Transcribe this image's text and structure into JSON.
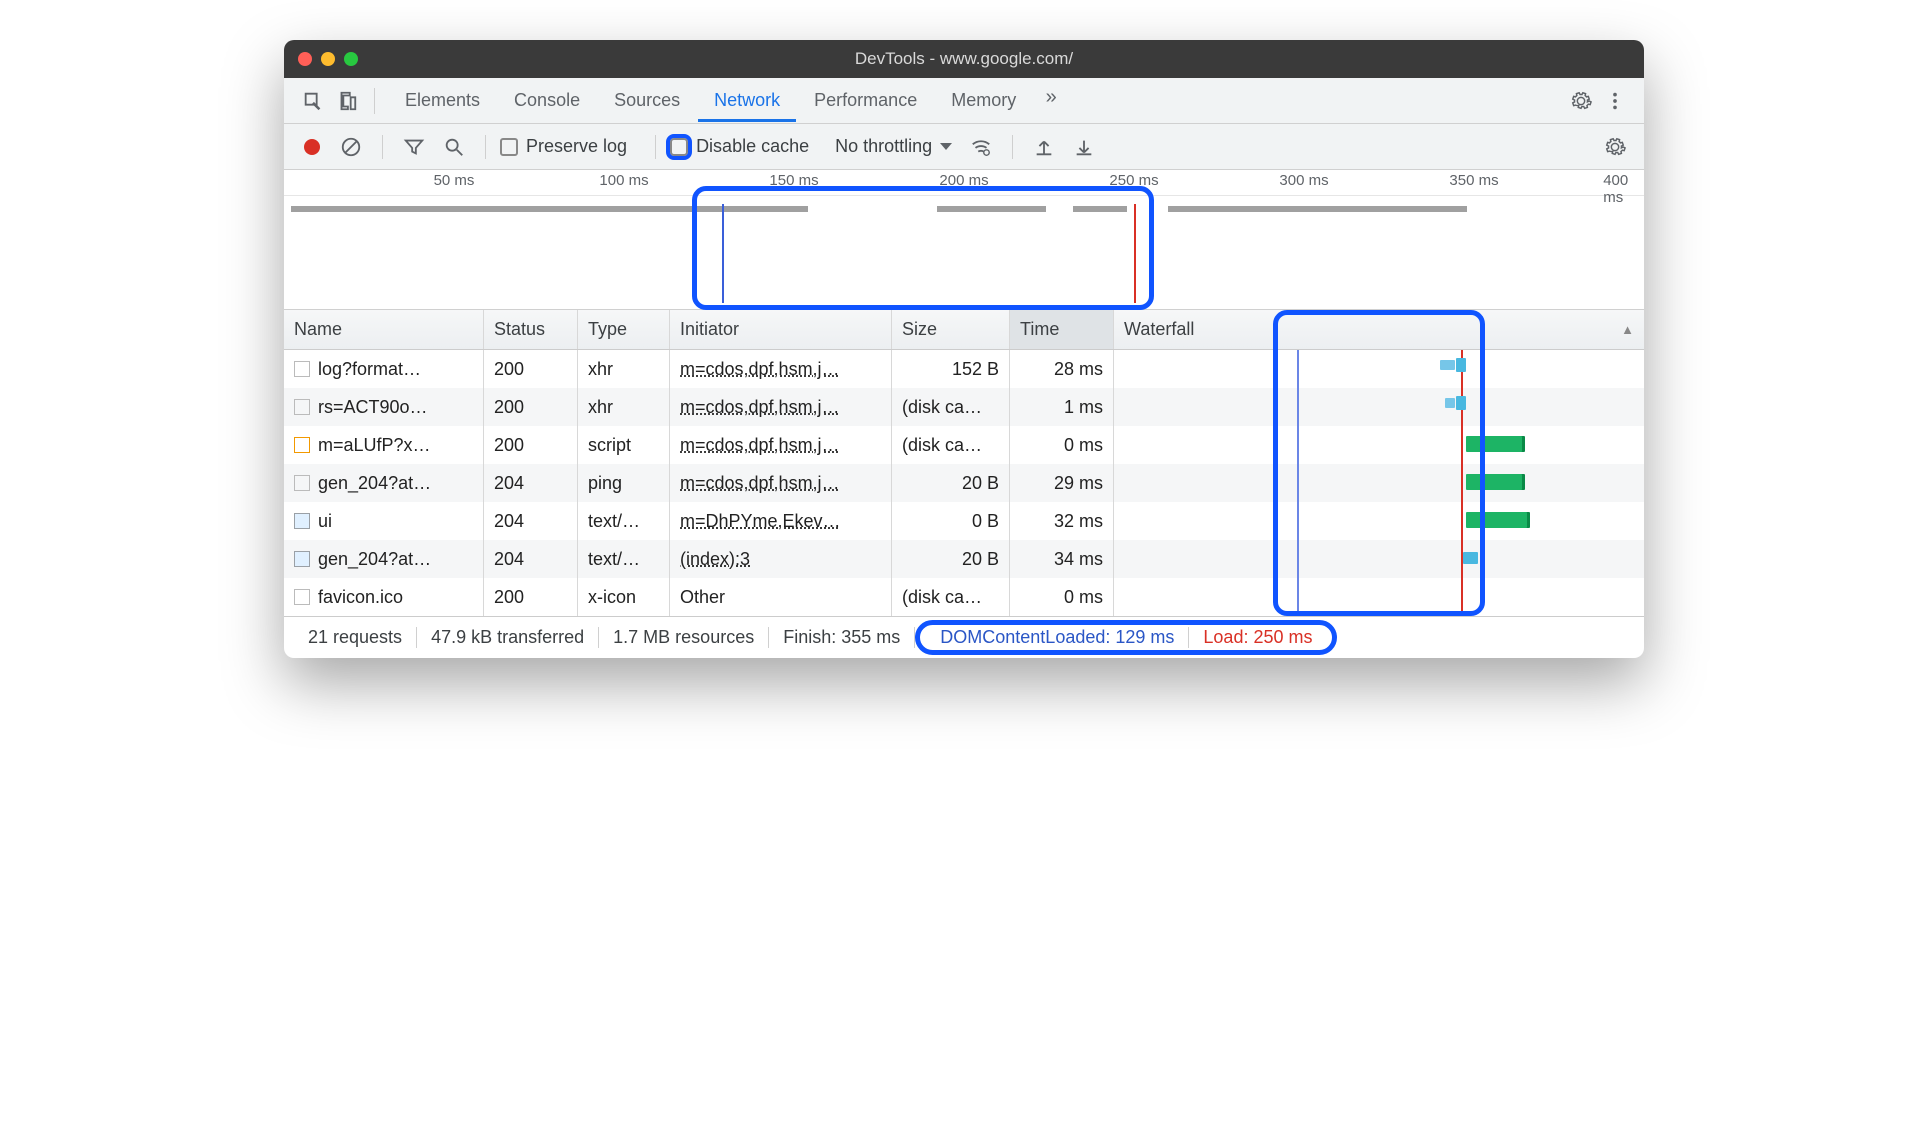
{
  "window": {
    "title": "DevTools - www.google.com/"
  },
  "tabs": {
    "elements": "Elements",
    "console": "Console",
    "sources": "Sources",
    "network": "Network",
    "performance": "Performance",
    "memory": "Memory"
  },
  "toolbar": {
    "preserve_log": "Preserve log",
    "disable_cache": "Disable cache",
    "throttling": "No throttling"
  },
  "overview": {
    "ticks": [
      "50 ms",
      "100 ms",
      "150 ms",
      "200 ms",
      "250 ms",
      "300 ms",
      "350 ms",
      "400 ms"
    ]
  },
  "columns": {
    "name": "Name",
    "status": "Status",
    "type": "Type",
    "initiator": "Initiator",
    "size": "Size",
    "time": "Time",
    "waterfall": "Waterfall"
  },
  "rows": [
    {
      "icon": "doc",
      "name": "log?format…",
      "status": "200",
      "type": "xhr",
      "initiator": "m=cdos,dpf,hsm,j…",
      "size": "152 B",
      "time": "28 ms"
    },
    {
      "icon": "doc",
      "name": "rs=ACT90o…",
      "status": "200",
      "type": "xhr",
      "initiator": "m=cdos,dpf,hsm,j…",
      "size": "(disk ca…",
      "time": "1 ms"
    },
    {
      "icon": "js",
      "name": "m=aLUfP?x…",
      "status": "200",
      "type": "script",
      "initiator": "m=cdos,dpf,hsm,j…",
      "size": "(disk ca…",
      "time": "0 ms"
    },
    {
      "icon": "doc",
      "name": "gen_204?at…",
      "status": "204",
      "type": "ping",
      "initiator": "m=cdos,dpf,hsm,j…",
      "size": "20 B",
      "time": "29 ms"
    },
    {
      "icon": "img",
      "name": "ui",
      "status": "204",
      "type": "text/…",
      "initiator": "m=DhPYme,Ekev…",
      "size": "0 B",
      "time": "32 ms"
    },
    {
      "icon": "img",
      "name": "gen_204?at…",
      "status": "204",
      "type": "text/…",
      "initiator": "(index):3",
      "size": "20 B",
      "time": "34 ms"
    },
    {
      "icon": "doc",
      "name": "favicon.ico",
      "status": "200",
      "type": "x-icon",
      "initiator": "Other",
      "size": "(disk ca…",
      "time": "0 ms"
    }
  ],
  "status": {
    "requests": "21 requests",
    "transferred": "47.9 kB transferred",
    "resources": "1.7 MB resources",
    "finish": "Finish: 355 ms",
    "dcl": "DOMContentLoaded: 129 ms",
    "load": "Load: 250 ms"
  }
}
